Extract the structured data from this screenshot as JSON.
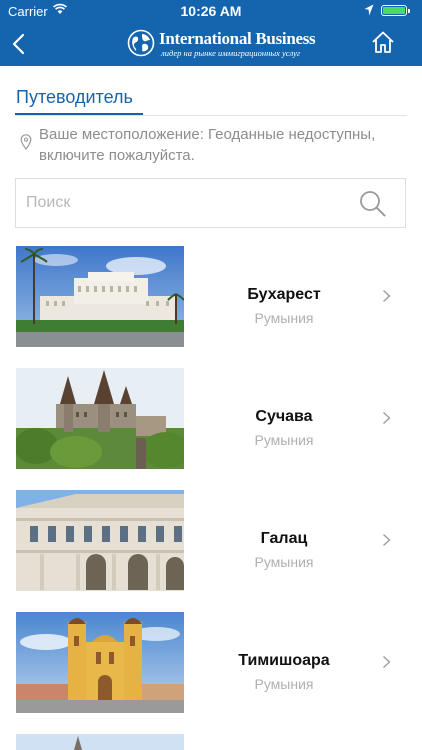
{
  "status_bar": {
    "carrier": "Carrier",
    "time": "10:26 AM"
  },
  "header": {
    "brand": "International Business",
    "tagline": "лидер на рынке иммиграционных услуг",
    "back_icon": "chevron-left-icon",
    "home_icon": "home-icon"
  },
  "tab": {
    "title": "Путеводитель"
  },
  "location": {
    "text": "Ваше местоположение: Геоданные недоступны, включите пожалуйста."
  },
  "search": {
    "placeholder": "Поиск",
    "value": ""
  },
  "cities": [
    {
      "name": "Бухарест",
      "country": "Румыния"
    },
    {
      "name": "Сучава",
      "country": "Румыния"
    },
    {
      "name": "Галац",
      "country": "Румыния"
    },
    {
      "name": "Тимишоара",
      "country": "Румыния"
    }
  ],
  "colors": {
    "brand_blue": "#1565ae",
    "battery_green": "#4cd964",
    "muted_text": "#8d8d8d"
  }
}
